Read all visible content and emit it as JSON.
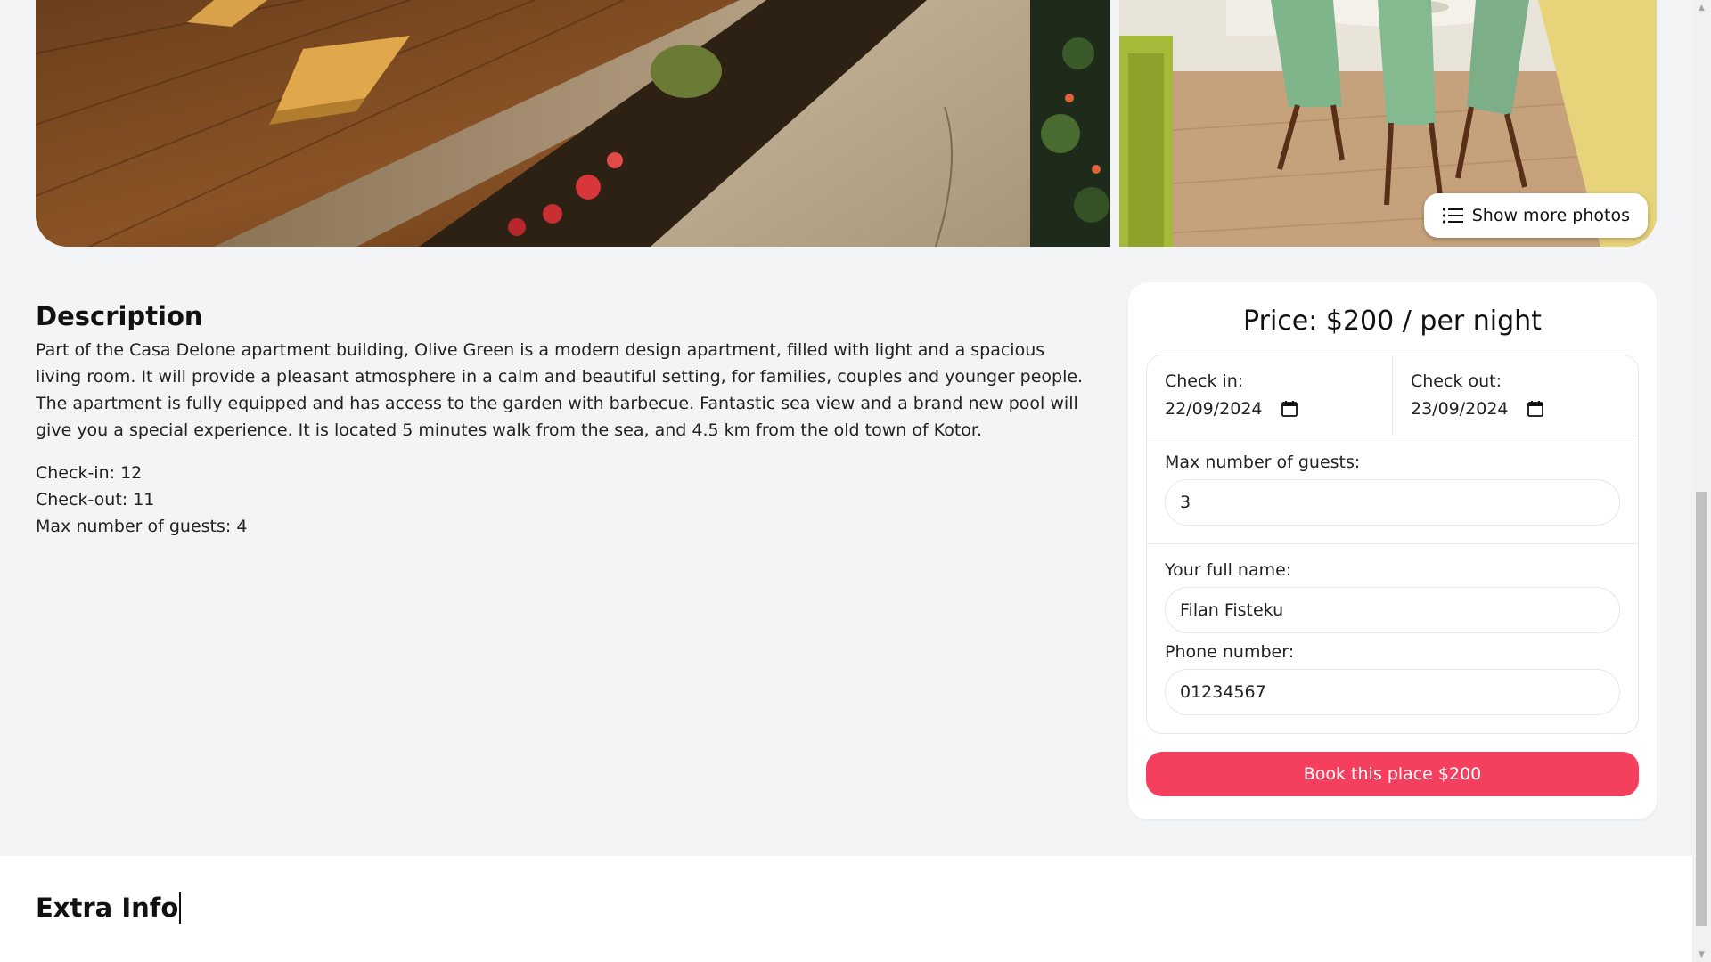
{
  "gallery": {
    "show_more_label": "Show more photos"
  },
  "description": {
    "heading": "Description",
    "text": "Part of the Casa Delone apartment building, Olive Green is a modern design apartment, filled with light and a spacious living room. It will provide a pleasant atmosphere in a calm and beautiful setting, for families, couples and younger people. The apartment is fully equipped and has access to the garden with barbecue. Fantastic sea view and a brand new pool will give you a special experience. It is located 5 minutes walk from the sea, and 4.5 km from the old town of Kotor.",
    "check_in": "Check-in: 12",
    "check_out": "Check-out: 11",
    "max_guests": "Max number of guests: 4"
  },
  "booking": {
    "price": "Price: $200 / per night",
    "check_in_label": "Check in:",
    "check_in_value": "22/09/2024",
    "check_out_label": "Check out:",
    "check_out_value": "23/09/2024",
    "guests_label": "Max number of guests:",
    "guests_value": "3",
    "name_label": "Your full name:",
    "name_value": "Filan Fisteku",
    "phone_label": "Phone number:",
    "phone_value": "01234567",
    "book_button": "Book this place $200",
    "accent_color": "#f43f5e"
  },
  "extra_info": {
    "heading": "Extra Info"
  }
}
